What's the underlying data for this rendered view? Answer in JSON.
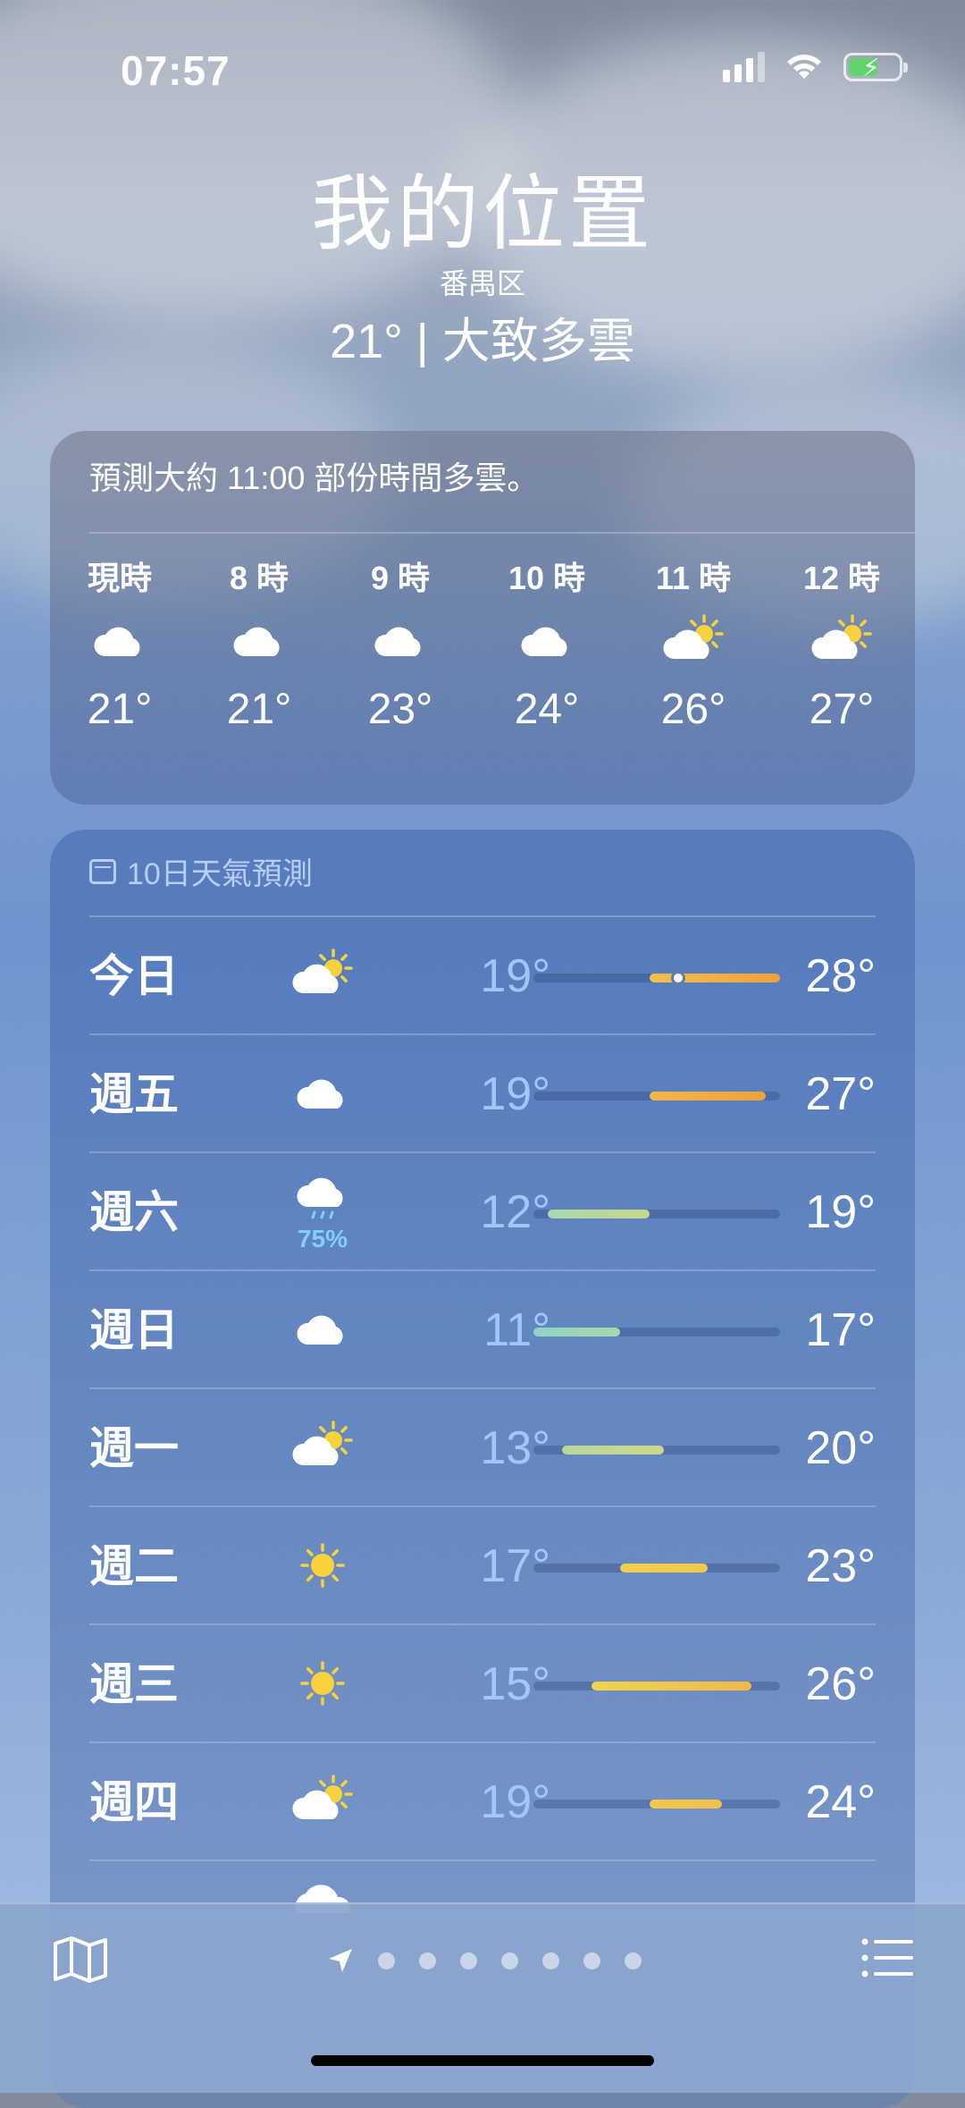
{
  "status_bar": {
    "time": "07:57"
  },
  "header": {
    "title": "我的位置",
    "district": "番禺区",
    "current": "21° | 大致多雲"
  },
  "hourly": {
    "summary": "預測大約 11:00 部份時間多雲。",
    "items": [
      {
        "label": "現時",
        "icon": "cloud-icon",
        "temp": "21°"
      },
      {
        "label": "8 時",
        "icon": "cloud-icon",
        "temp": "21°"
      },
      {
        "label": "9 時",
        "icon": "cloud-icon",
        "temp": "23°"
      },
      {
        "label": "10 時",
        "icon": "cloud-icon",
        "temp": "24°"
      },
      {
        "label": "11 時",
        "icon": "partly-sunny-icon",
        "temp": "26°"
      },
      {
        "label": "12 時",
        "icon": "partly-sunny-icon",
        "temp": "27°"
      }
    ]
  },
  "daily": {
    "heading": "10日天氣預測",
    "range_min": 11,
    "range_max": 28,
    "days": [
      {
        "day": "今日",
        "icon": "partly-sunny-icon",
        "low": "19°",
        "high": "28°",
        "lo": 19,
        "hi": 28,
        "current": 21,
        "colors": [
          "#f2c14a",
          "#f0a03a"
        ]
      },
      {
        "day": "週五",
        "icon": "cloud-icon",
        "low": "19°",
        "high": "27°",
        "lo": 19,
        "hi": 27,
        "colors": [
          "#f2b64a",
          "#f0a03a"
        ]
      },
      {
        "day": "週六",
        "icon": "cloud-rain-icon",
        "precip": "75%",
        "low": "12°",
        "high": "19°",
        "lo": 12,
        "hi": 19,
        "colors": [
          "#a8d8b0",
          "#c9d88a"
        ]
      },
      {
        "day": "週日",
        "icon": "cloud-icon",
        "low": "11°",
        "high": "17°",
        "lo": 11,
        "hi": 17,
        "colors": [
          "#8fd3c8",
          "#a7d8a8"
        ]
      },
      {
        "day": "週一",
        "icon": "partly-sunny-icon",
        "low": "13°",
        "high": "20°",
        "lo": 13,
        "hi": 20,
        "colors": [
          "#b8d89a",
          "#cdd88a"
        ]
      },
      {
        "day": "週二",
        "icon": "sun-icon",
        "low": "17°",
        "high": "23°",
        "lo": 17,
        "hi": 23,
        "colors": [
          "#f2d04a",
          "#f2c84a"
        ]
      },
      {
        "day": "週三",
        "icon": "sun-icon",
        "low": "15°",
        "high": "26°",
        "lo": 15,
        "hi": 26,
        "colors": [
          "#efd44e",
          "#f2b84a"
        ]
      },
      {
        "day": "週四",
        "icon": "partly-sunny-icon",
        "low": "19°",
        "high": "24°",
        "lo": 19,
        "hi": 24,
        "colors": [
          "#f2c84a",
          "#f2c04a"
        ]
      }
    ]
  },
  "bottom_bar": {
    "map_icon": "map-icon",
    "list_icon": "list-icon",
    "location_icon": "location-arrow-icon",
    "page_dots": 7
  }
}
